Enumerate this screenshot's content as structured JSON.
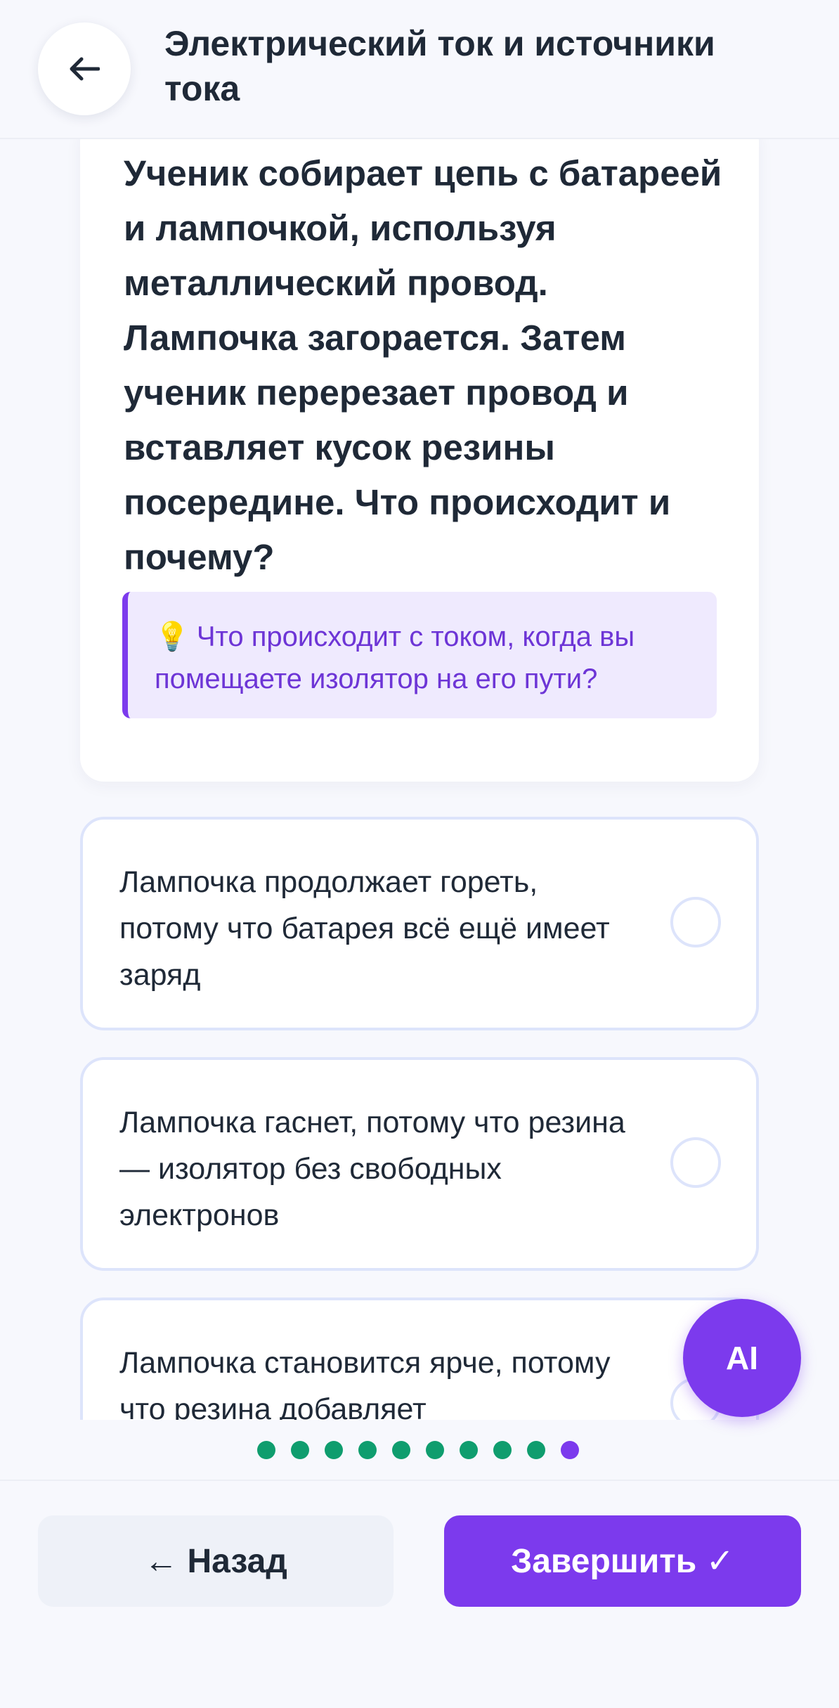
{
  "header": {
    "title": "Электрический ток и источники тока",
    "back_icon": "arrow-left-icon"
  },
  "question": {
    "text": "Ученик собирает цепь с батареей и лампочкой, используя металлический провод. Лампочка загорается. Затем ученик перерезает провод и вставляет кусок резины посередине. Что происходит и почему?",
    "hint_icon": "lightbulb-icon",
    "hint_glyph": "💡",
    "hint": "Что происходит с током, когда вы помещаете изолятор на его пути?"
  },
  "options": [
    {
      "label": "Лампочка продолжает гореть, потому что батарея всё ещё имеет заряд",
      "selected": false
    },
    {
      "label": "Лампочка гаснет, потому что резина — изолятор без свободных электронов",
      "selected": false
    },
    {
      "label": "Лампочка становится ярче, потому что резина добавляет",
      "selected": false
    }
  ],
  "ai_button": {
    "label": "AI"
  },
  "progress": {
    "total": 10,
    "current": 10,
    "completed_color": "#0f9d6e",
    "active_color": "#7c3aed"
  },
  "footer": {
    "back_label": "← Назад",
    "finish_label": "Завершить ✓"
  },
  "colors": {
    "accent": "#7c3aed",
    "hint_bg": "#efeafe",
    "page_bg": "#f7f8fd"
  }
}
